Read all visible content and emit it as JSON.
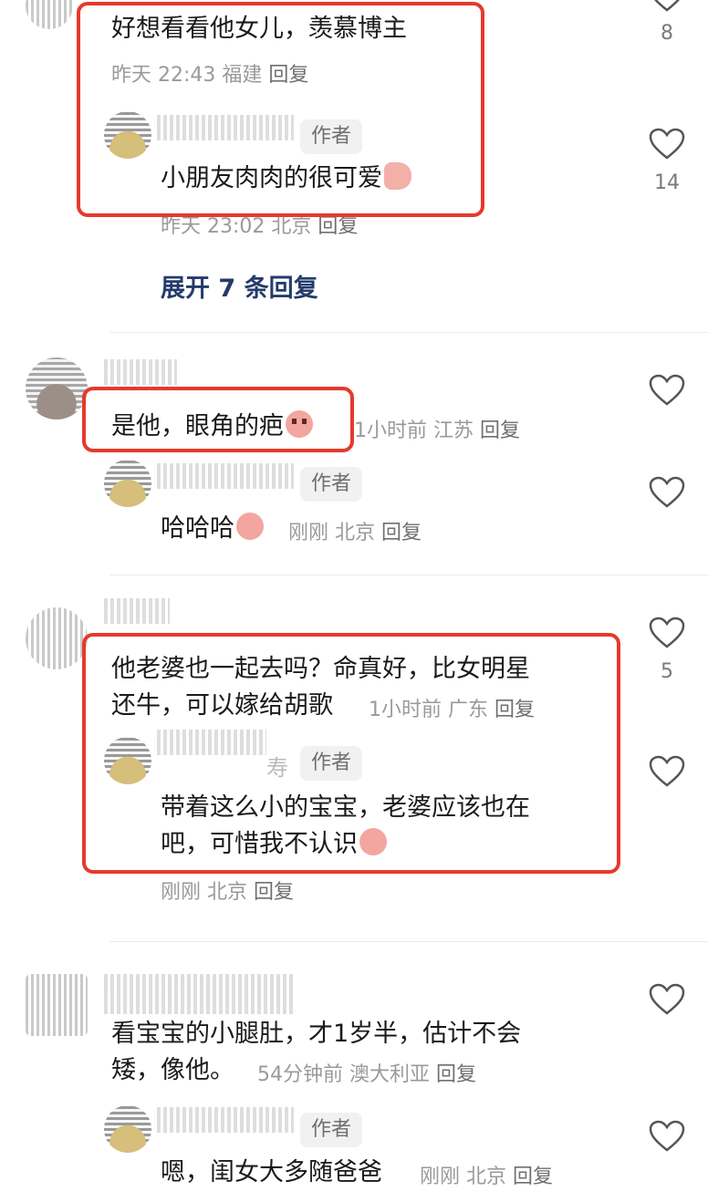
{
  "thread1": {
    "comment": "好想看看他女儿，羡慕博主",
    "time": "昨天 22:43",
    "location": "福建",
    "reply_label": "回复",
    "likes_top": "8",
    "reply": {
      "tag": "作者",
      "text": "小朋友肉肉的很可爱",
      "time": "昨天 23:02",
      "location": "北京",
      "reply_label": "回复",
      "likes": "14"
    },
    "expand_label": "展开 7 条回复"
  },
  "thread2": {
    "comment": "是他，眼角的疤",
    "time": "1小时前",
    "location": "江苏",
    "reply_label": "回复",
    "reply": {
      "tag": "作者",
      "text": "哈哈哈",
      "time": "刚刚",
      "location": "北京",
      "reply_label": "回复"
    }
  },
  "thread3": {
    "comment_line1": "他老婆也一起去吗？命真好，比女明星",
    "comment_line2": "还牛，可以嫁给胡歌",
    "time": "1小时前",
    "location": "广东",
    "reply_label": "回复",
    "likes": "5",
    "reply": {
      "name_suffix": "寿",
      "tag": "作者",
      "text_line1": "带着这么小的宝宝，老婆应该也在",
      "text_line2": "吧，可惜我不认识",
      "time": "刚刚",
      "location": "北京",
      "reply_label": "回复"
    }
  },
  "thread4": {
    "comment_line1": "看宝宝的小腿肚，才1岁半，估计不会",
    "comment_line2": "矮，像他。",
    "time": "54分钟前",
    "location": "澳大利亚",
    "reply_label": "回复",
    "reply": {
      "tag": "作者",
      "text": "嗯，闺女大多随爸爸",
      "time": "刚刚",
      "location": "北京",
      "reply_label": "回复"
    }
  },
  "icons": {
    "like": "heart-outline-icon"
  },
  "colors": {
    "highlight_box": "#e53a2c",
    "expand_link": "#243b6b"
  }
}
